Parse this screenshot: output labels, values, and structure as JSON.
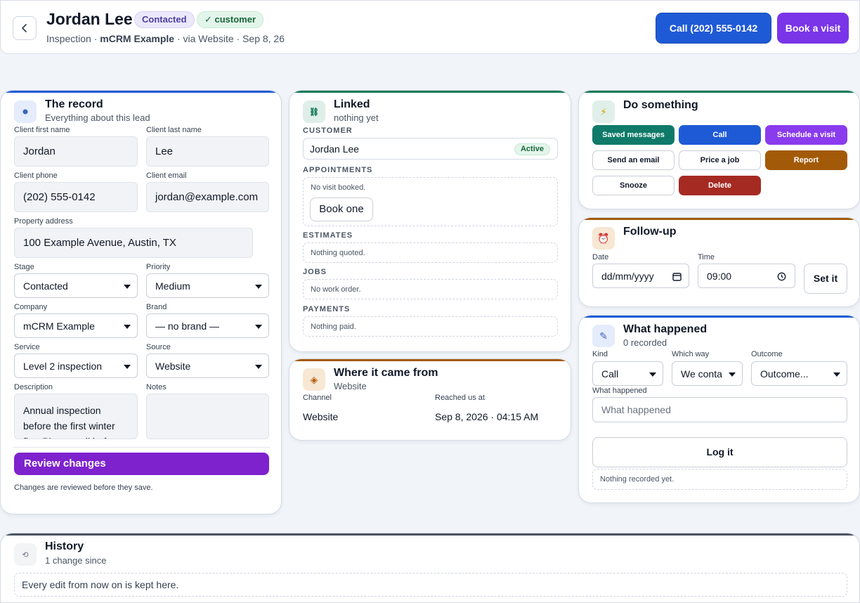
{
  "header": {
    "title": "Jordan Lee",
    "badge_contacted": "Contacted",
    "badge_customer": "customer",
    "subtitle_inspection": "Inspection · ",
    "subtitle_company": "mCRM Example",
    "subtitle_rest": " · via Website · Sep 8, 26",
    "call_label": "Call (202) 555-0142",
    "book_label": "Book a visit"
  },
  "record": {
    "title": "The record",
    "subtitle": "Everything about this lead",
    "first_name_label": "Client first name",
    "first_name": "Jordan",
    "last_name_label": "Client last name",
    "last_name": "Lee",
    "phone_label": "Client phone",
    "phone": "(202) 555-0142",
    "email_label": "Client email",
    "email": "jordan@example.com",
    "address_label": "Property address",
    "address": "100 Example Avenue, Austin, TX",
    "stage_label": "Stage",
    "stage": "Contacted",
    "priority_label": "Priority",
    "priority": "Medium",
    "company_label": "Company",
    "company": "mCRM Example",
    "brand_label": "Brand",
    "brand": "— no brand —",
    "service_label": "Service",
    "service": "Level 2 inspection",
    "source_label": "Source",
    "source": "Website",
    "description_label": "Description",
    "description": "Annual inspection before the first winter fire. Please call before arriving.",
    "notes_label": "Notes",
    "review_label": "Review changes",
    "review_note": "Changes are reviewed before they save."
  },
  "linked": {
    "title": "Linked",
    "subtitle": "nothing yet",
    "customer_label": "CUSTOMER",
    "customer_name": "Jordan Lee",
    "customer_status": "Active",
    "appointments_label": "APPOINTMENTS",
    "appointments_empty": "No visit booked.",
    "book_one": "Book one",
    "estimates_label": "ESTIMATES",
    "estimates_empty": "Nothing quoted.",
    "jobs_label": "JOBS",
    "jobs_empty": "No work order.",
    "payments_label": "PAYMENTS",
    "payments_empty": "Nothing paid."
  },
  "origin": {
    "title": "Where it came from",
    "subtitle": "Website",
    "channel_label": "Channel",
    "channel": "Website",
    "reached_label": "Reached us at",
    "reached": "Sep 8, 2026 · 04:15 AM"
  },
  "actions": {
    "title": "Do something",
    "saved_messages": "Saved messages",
    "call": "Call",
    "schedule": "Schedule a visit",
    "send_email": "Send an email",
    "price_job": "Price a job",
    "report": "Report",
    "snooze": "Snooze",
    "delete": "Delete"
  },
  "followup": {
    "title": "Follow-up",
    "date_label": "Date",
    "date_placeholder": "dd/mm/yyyy",
    "time_label": "Time",
    "time": "09:00",
    "set_label": "Set it"
  },
  "happened": {
    "title": "What happened",
    "subtitle": "0 recorded",
    "kind_label": "Kind",
    "kind": "Call",
    "way_label": "Which way",
    "way": "We conta",
    "outcome_label": "Outcome",
    "outcome": "Outcome...",
    "what_label": "What happened",
    "what_placeholder": "What happened",
    "log_label": "Log it",
    "empty": "Nothing recorded yet."
  },
  "history": {
    "title": "History",
    "subtitle": "1 change since",
    "note": "Every edit from now on is kept here."
  },
  "colors": {
    "blue": "#1f5ad6",
    "purple": "#7a35e8",
    "teal": "#0f7a69",
    "amber": "#a35a08",
    "red": "#a52a22",
    "green": "#17663a"
  }
}
